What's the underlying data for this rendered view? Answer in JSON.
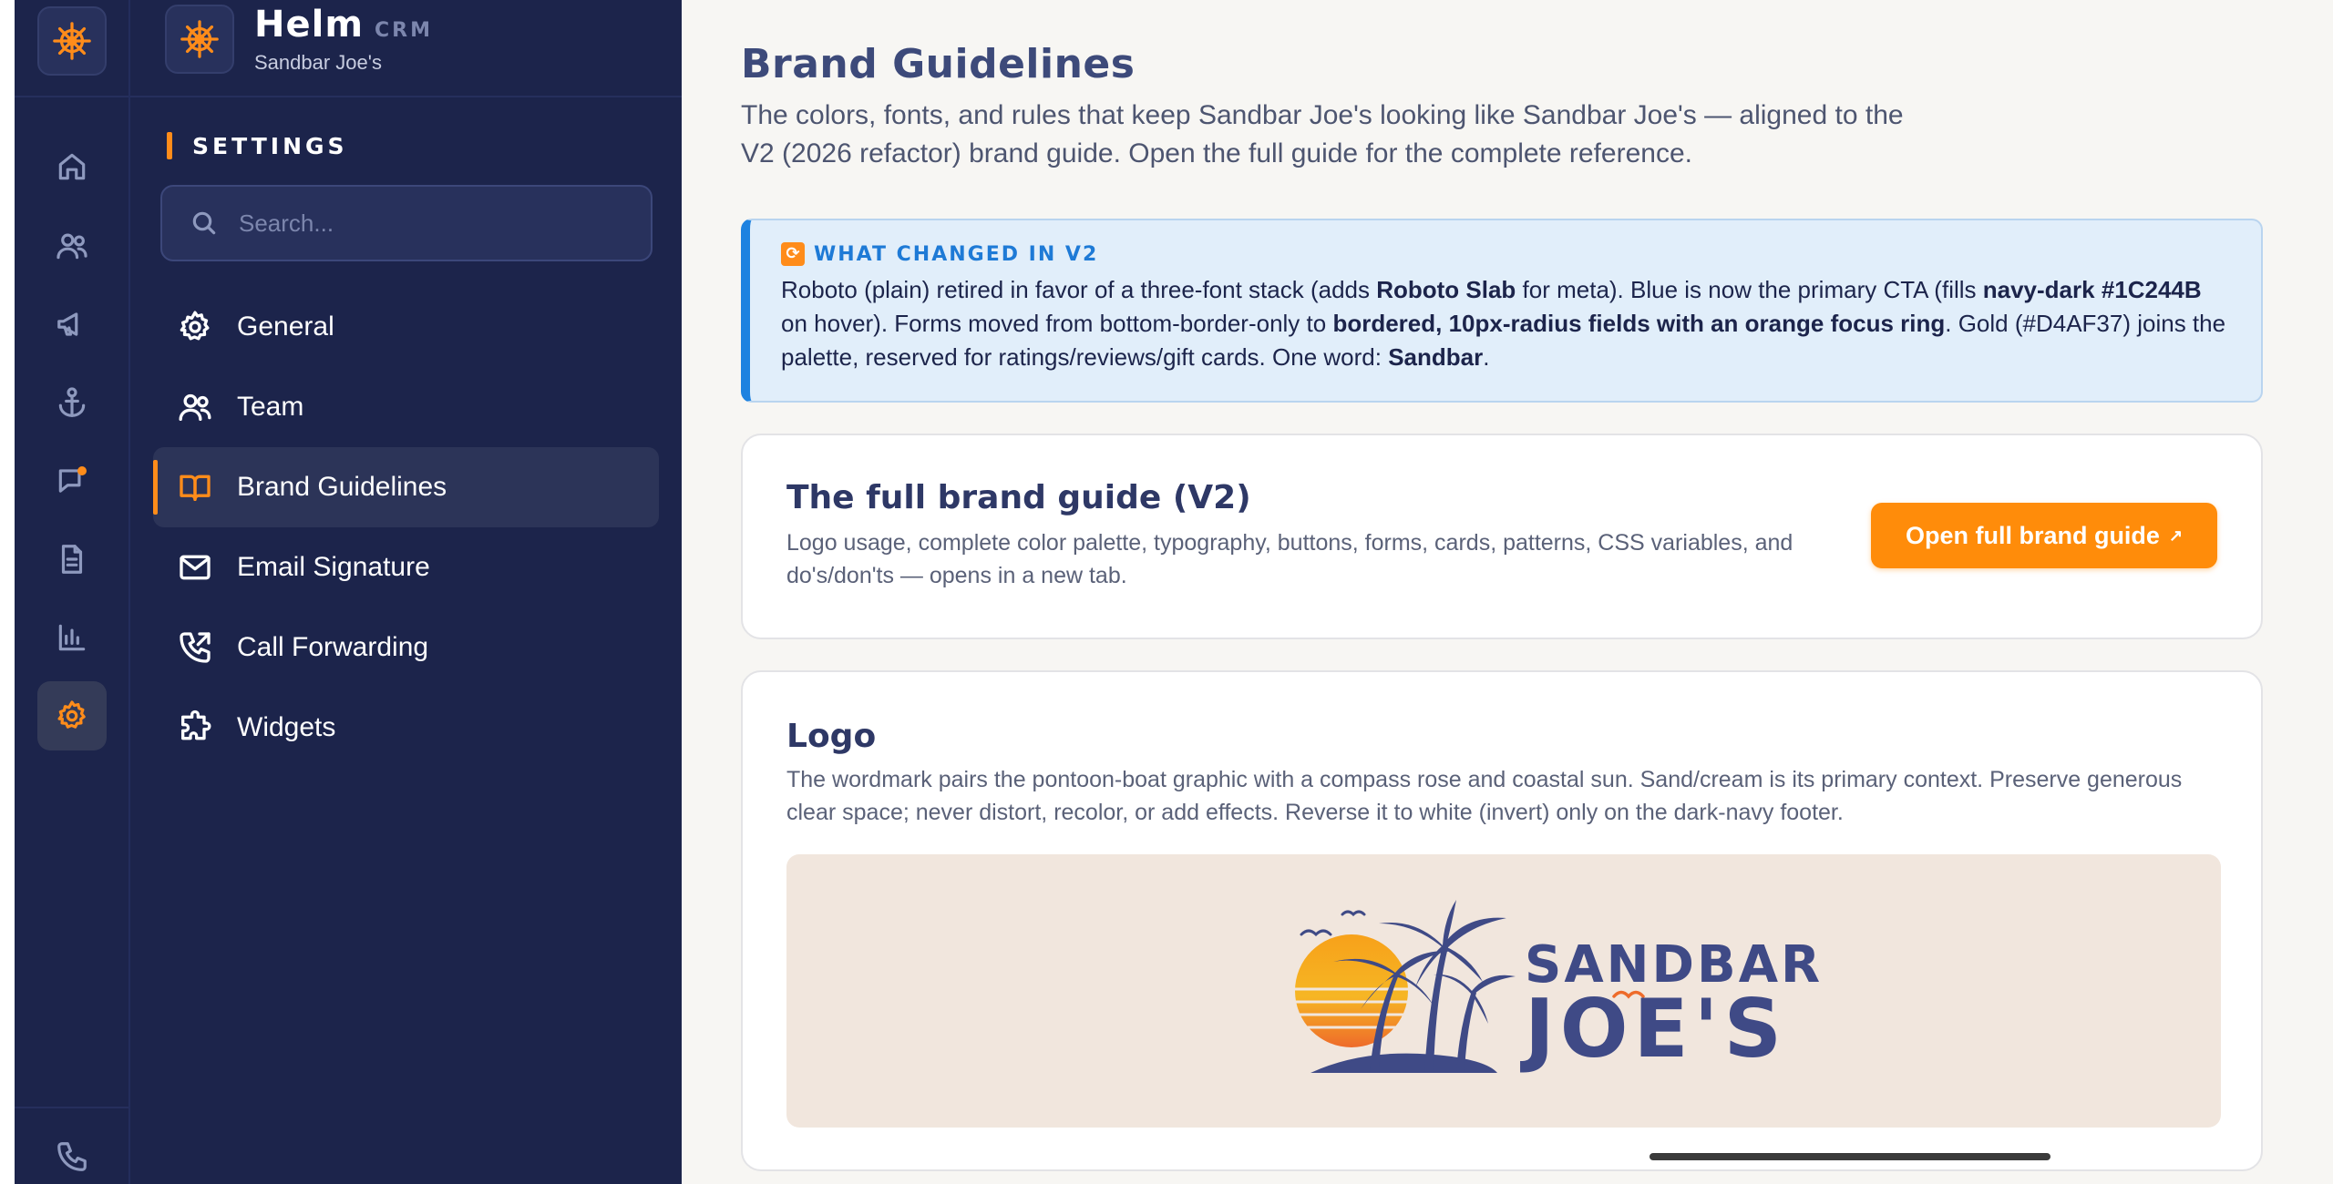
{
  "app": {
    "name": "Helm",
    "tag": "CRM",
    "account": "Sandbar Joe's",
    "logo_icon": "ship-wheel-icon",
    "accent_color": "#FF8C1A",
    "nav_color": "#1C244B"
  },
  "rail": {
    "items": [
      {
        "icon": "home-icon"
      },
      {
        "icon": "users-icon"
      },
      {
        "icon": "megaphone-icon"
      },
      {
        "icon": "anchor-icon"
      },
      {
        "icon": "message-icon",
        "has_notification": true
      },
      {
        "icon": "document-icon"
      },
      {
        "icon": "bar-chart-icon"
      },
      {
        "icon": "gear-icon",
        "active": true
      }
    ],
    "bottom": [
      {
        "icon": "phone-icon"
      }
    ]
  },
  "settings": {
    "section_label": "SETTINGS",
    "search_placeholder": "Search...",
    "items": [
      {
        "label": "General",
        "icon": "gear-icon"
      },
      {
        "label": "Team",
        "icon": "users-icon"
      },
      {
        "label": "Brand Guidelines",
        "icon": "book-open-icon",
        "active": true
      },
      {
        "label": "Email Signature",
        "icon": "mail-icon"
      },
      {
        "label": "Call Forwarding",
        "icon": "phone-forward-icon"
      },
      {
        "label": "Widgets",
        "icon": "puzzle-icon"
      }
    ]
  },
  "main": {
    "title": "Brand Guidelines",
    "description": "The colors, fonts, and rules that keep Sandbar Joe's looking like Sandbar Joe's — aligned to the V2 (2026 refactor) brand guide. Open the full guide for the complete reference.",
    "callout": {
      "icon": "refresh-emoji",
      "title": "WHAT CHANGED IN V2",
      "parts": [
        {
          "t": "Roboto (plain) retired in favor of a three-font stack (adds "
        },
        {
          "t": "Roboto Slab",
          "b": true
        },
        {
          "t": " for meta). Blue is now the primary CTA (fills "
        },
        {
          "t": "navy-dark #1C244B",
          "b": true
        },
        {
          "t": " on hover). Forms moved from bottom-border-only to "
        },
        {
          "t": "bordered, 10px-radius fields with an orange focus ring",
          "b": true
        },
        {
          "t": ". Gold (#D4AF37) joins the palette, reserved for ratings/reviews/gift cards. One word: "
        },
        {
          "t": "Sandbar",
          "b": true
        },
        {
          "t": "."
        }
      ]
    },
    "guide_card": {
      "title": "The full brand guide (V2)",
      "description": "Logo usage, complete color palette, typography, buttons, forms, cards, patterns, CSS variables, and do's/don'ts — opens in a new tab.",
      "button_label": "Open full brand guide",
      "button_icon": "external-arrow-icon"
    },
    "logo_card": {
      "title": "Logo",
      "description": "The wordmark pairs the pontoon-boat graphic with a compass rose and coastal sun. Sand/cream is its primary context. Preserve generous clear space; never distort, recolor, or add effects. Reverse it to white (invert) only on the dark-navy footer.",
      "wordmark_line1": "SANDBAR",
      "wordmark_line2": "JOE'S",
      "stage_color": "#F1E6DD"
    }
  }
}
